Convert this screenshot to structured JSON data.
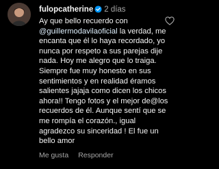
{
  "comment": {
    "username": "fulopcatherine",
    "time_ago": "2 días",
    "text_before_mention": "Ay que bello recuerdo con ",
    "mention": "@guillermodavilaoficial",
    "text_after_mention": " la verdad, me encanta que él lo haya recordado, yo nunca por respeto a sus parejas dije nada. Hoy me alegro que lo traiga. Siempre fue muy honesto en sus sentimientos y en realidad éramos salientes jajaja como dicen los chicos ahora!! Tengo fotos y el mejor de@los recuerdos de él. Aunque sentí que se me rompía el corazón., igual agradezco su sinceridad ! El fue un bello amor",
    "like_label": "Me gusta",
    "reply_label": "Responder"
  },
  "colors": {
    "background": "#000000",
    "text": "#f5f5f5",
    "secondary_text": "#a8a8a8",
    "mention": "#e0f1ff",
    "verified_badge": "#0095f6"
  },
  "icons": {
    "verified": "verified-badge-icon",
    "like": "heart-outline-icon"
  }
}
